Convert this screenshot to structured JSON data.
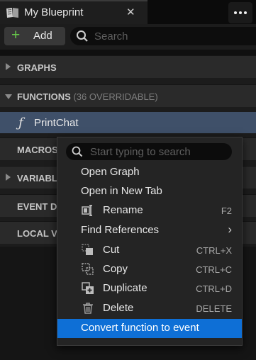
{
  "tab": {
    "title": "My Blueprint",
    "close": "✕"
  },
  "toolbar": {
    "add_label": "Add",
    "search_placeholder": "Search"
  },
  "sections": {
    "graphs": "GRAPHS",
    "functions": "FUNCTIONS",
    "functions_sub": "(36 OVERRIDABLE)",
    "macros": "MACROS",
    "variables": "VARIABLES",
    "event_dispatchers": "EVENT DISPATCHERS",
    "local_variables": "LOCAL VARIABLES"
  },
  "function_item": {
    "icon": "ƒ",
    "label": "PrintChat"
  },
  "context_menu": {
    "search_placeholder": "Start typing to search",
    "items": [
      {
        "label": "Open Graph",
        "shortcut": ""
      },
      {
        "label": "Open in New Tab",
        "shortcut": ""
      },
      {
        "label": "Rename",
        "shortcut": "F2",
        "icon": "rename-icon"
      },
      {
        "label": "Find References",
        "shortcut": "",
        "submenu": "›"
      },
      {
        "label": "Cut",
        "shortcut": "CTRL+X",
        "icon": "cut-icon"
      },
      {
        "label": "Copy",
        "shortcut": "CTRL+C",
        "icon": "copy-icon"
      },
      {
        "label": "Duplicate",
        "shortcut": "CTRL+D",
        "icon": "duplicate-icon"
      },
      {
        "label": "Delete",
        "shortcut": "DELETE",
        "icon": "trash-icon"
      },
      {
        "label": "Convert function to event",
        "shortcut": ""
      }
    ]
  },
  "colors": {
    "accent": "#0e6fd6",
    "add_plus": "#66c84a",
    "selected_row": "#3f5069"
  }
}
